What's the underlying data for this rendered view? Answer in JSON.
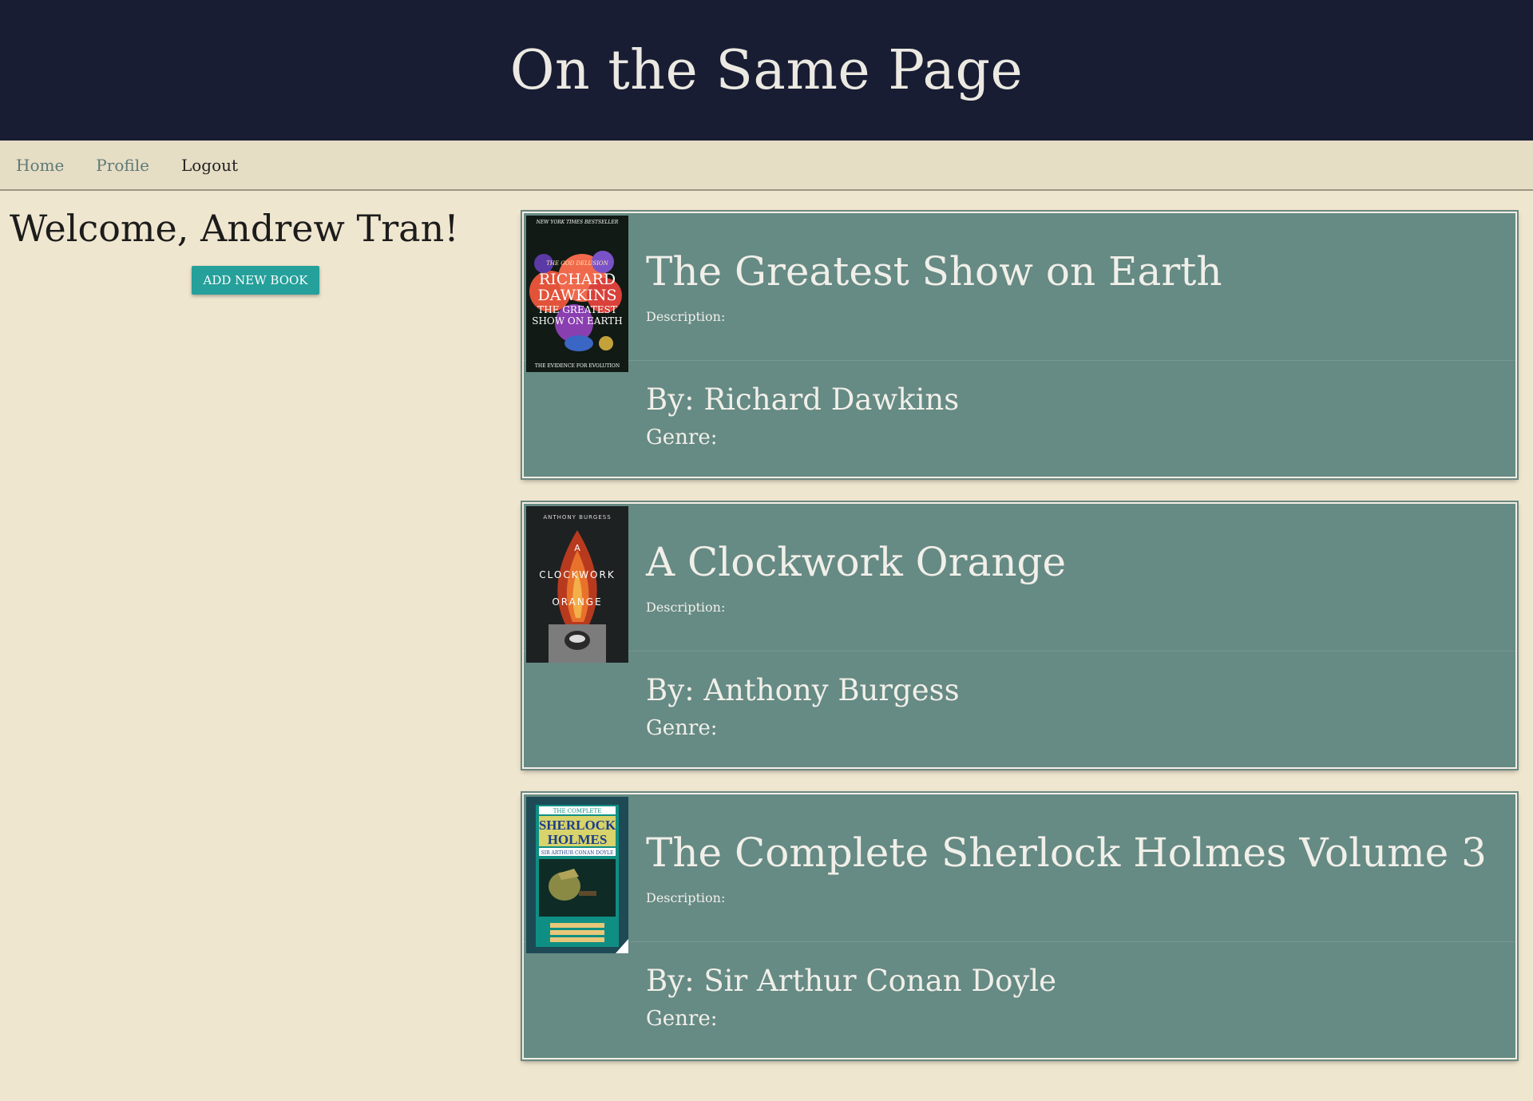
{
  "header": {
    "title": "On the Same Page"
  },
  "nav": {
    "home": "Home",
    "profile": "Profile",
    "logout": "Logout"
  },
  "sidebar": {
    "welcome": "Welcome, Andrew Tran!",
    "add_button": "ADD NEW BOOK"
  },
  "labels": {
    "description": "Description:",
    "genre": "Genre:"
  },
  "books": [
    {
      "title": "The Greatest Show on Earth",
      "author": "By: Richard Dawkins",
      "cover": {
        "top": "NEW YORK TIMES BESTSELLER",
        "line1": "THE GOD DELUSION",
        "line2": "RICHARD",
        "line3": "DAWKINS",
        "line4": "THE GREATEST",
        "line5": "SHOW ON EARTH",
        "bottom": "THE EVIDENCE FOR EVOLUTION"
      }
    },
    {
      "title": "A Clockwork Orange",
      "author": "By: Anthony Burgess",
      "cover": {
        "top": "ANTHONY BURGESS",
        "line1": "A",
        "line2": "CLOCKWORK",
        "line3": "ORANGE"
      }
    },
    {
      "title": "The Complete Sherlock Holmes Volume 3",
      "author": "By: Sir Arthur Conan Doyle",
      "cover": {
        "top": "THE COMPLETE",
        "line1": "SHERLOCK",
        "line2": "HOLMES",
        "line3": "SIR ARTHUR CONAN DOYLE"
      }
    }
  ],
  "colors": {
    "header_bg": "#181d33",
    "nav_bg": "#e6ddc5",
    "page_bg": "#efe6cf",
    "card_bg": "#668a84",
    "button_bg": "#25a09b"
  }
}
